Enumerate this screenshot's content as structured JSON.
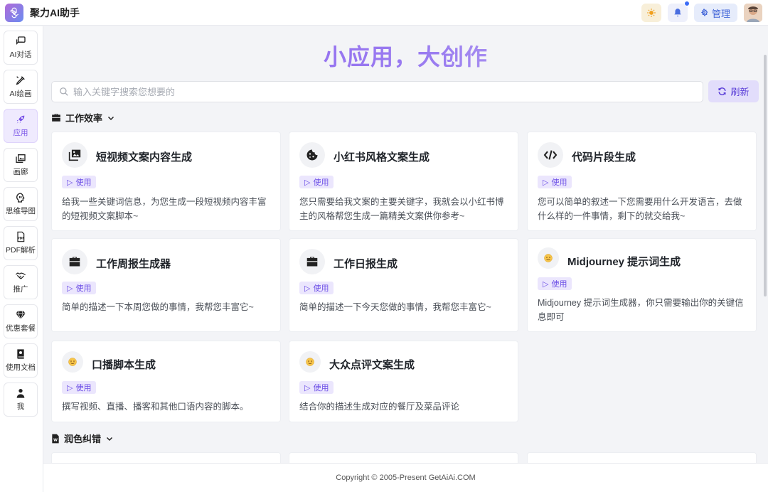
{
  "app": {
    "title": "聚力AI助手"
  },
  "header": {
    "admin_label": "管理"
  },
  "sidebar": {
    "items": [
      {
        "label": "AI对话",
        "icon": "chat-icon"
      },
      {
        "label": "AI绘画",
        "icon": "brush-icon"
      },
      {
        "label": "应用",
        "icon": "rocket-icon",
        "active": true
      },
      {
        "label": "画廊",
        "icon": "gallery-icon"
      },
      {
        "label": "思维导图",
        "icon": "mindmap-icon"
      },
      {
        "label": "PDF解析",
        "icon": "pdf-icon"
      },
      {
        "label": "推广",
        "icon": "handshake-icon"
      },
      {
        "label": "优惠套餐",
        "icon": "diamond-icon"
      },
      {
        "label": "使用文档",
        "icon": "book-icon"
      },
      {
        "label": "我",
        "icon": "user-icon"
      }
    ]
  },
  "main": {
    "hero": "小应用，大创作",
    "search_placeholder": "输入关键字搜索您想要的",
    "refresh_label": "刷新",
    "sections": [
      {
        "title": "工作效率",
        "cards": [
          {
            "title": "短视频文案内容生成",
            "icon": "images-icon",
            "use_label": "使用",
            "desc": "给我一些关键词信息，为您生成一段短视频内容丰富的短视频文案脚本~"
          },
          {
            "title": "小红书风格文案生成",
            "icon": "cookie-icon",
            "use_label": "使用",
            "desc": "您只需要给我文案的主要关键字，我就会以小红书博主的风格帮您生成一篇精美文案供你参考~"
          },
          {
            "title": "代码片段生成",
            "icon": "code-icon",
            "use_label": "使用",
            "desc": "您可以简单的叙述一下您需要用什么开发语言，去做什么样的一件事情，剩下的就交给我~"
          },
          {
            "title": "工作周报生成器",
            "icon": "briefcase-icon",
            "use_label": "使用",
            "desc": "简单的描述一下本周您做的事情，我帮您丰富它~"
          },
          {
            "title": "工作日报生成",
            "icon": "briefcase-icon",
            "use_label": "使用",
            "desc": "简单的描述一下今天您做的事情，我帮您丰富它~"
          },
          {
            "title": "Midjourney 提示词生成",
            "icon": "smile-emoji-icon",
            "use_label": "使用",
            "desc": "Midjourney 提示词生成器，你只需要输出你的关键信息即可"
          },
          {
            "title": "口播脚本生成",
            "icon": "smile-emoji-icon",
            "use_label": "使用",
            "desc": "撰写视频、直播、播客和其他口语内容的脚本。"
          },
          {
            "title": "大众点评文案生成",
            "icon": "smile-emoji-icon",
            "use_label": "使用",
            "desc": "结合你的描述生成对应的餐厅及菜品评论"
          }
        ]
      },
      {
        "title": "润色纠错"
      }
    ]
  },
  "footer": {
    "copyright": "Copyright © 2005-Present GetAiAi.COM"
  },
  "colors": {
    "accent": "#7a55e8",
    "accent_bg": "#ebe6fd",
    "notify_dot": "#3b6cf6"
  }
}
